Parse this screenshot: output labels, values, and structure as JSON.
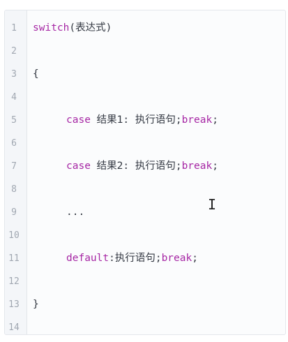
{
  "editor": {
    "lines": [
      {
        "num": "1",
        "segments": [
          {
            "text": "switch",
            "kind": "kw"
          },
          {
            "text": "(表达式)",
            "kind": "plain"
          }
        ]
      },
      {
        "num": "2",
        "segments": []
      },
      {
        "num": "3",
        "segments": [
          {
            "text": "{",
            "kind": "plain"
          }
        ]
      },
      {
        "num": "4",
        "segments": []
      },
      {
        "num": "5",
        "segments": [
          {
            "text": "case",
            "kind": "kw"
          },
          {
            "text": " 结果1: 执行语句;",
            "kind": "plain"
          },
          {
            "text": "break",
            "kind": "kw"
          },
          {
            "text": ";",
            "kind": "plain"
          }
        ]
      },
      {
        "num": "6",
        "segments": []
      },
      {
        "num": "7",
        "segments": [
          {
            "text": "case",
            "kind": "kw"
          },
          {
            "text": " 结果2: 执行语句;",
            "kind": "plain"
          },
          {
            "text": "break",
            "kind": "kw"
          },
          {
            "text": ";",
            "kind": "plain"
          }
        ]
      },
      {
        "num": "8",
        "segments": []
      },
      {
        "num": "9",
        "segments": [
          {
            "text": "...",
            "kind": "plain"
          }
        ]
      },
      {
        "num": "10",
        "segments": []
      },
      {
        "num": "11",
        "segments": [
          {
            "text": "default",
            "kind": "kw"
          },
          {
            "text": ":执行语句;",
            "kind": "plain"
          },
          {
            "text": "break",
            "kind": "kw"
          },
          {
            "text": ";",
            "kind": "plain"
          }
        ]
      },
      {
        "num": "12",
        "segments": []
      },
      {
        "num": "13",
        "segments": [
          {
            "text": "}",
            "kind": "plain"
          }
        ]
      },
      {
        "num": "14",
        "segments": []
      }
    ],
    "cursor_glyph": "I"
  },
  "colors": {
    "keyword": "#a626a4",
    "text": "#333842",
    "line_number": "#a0a7b1"
  }
}
